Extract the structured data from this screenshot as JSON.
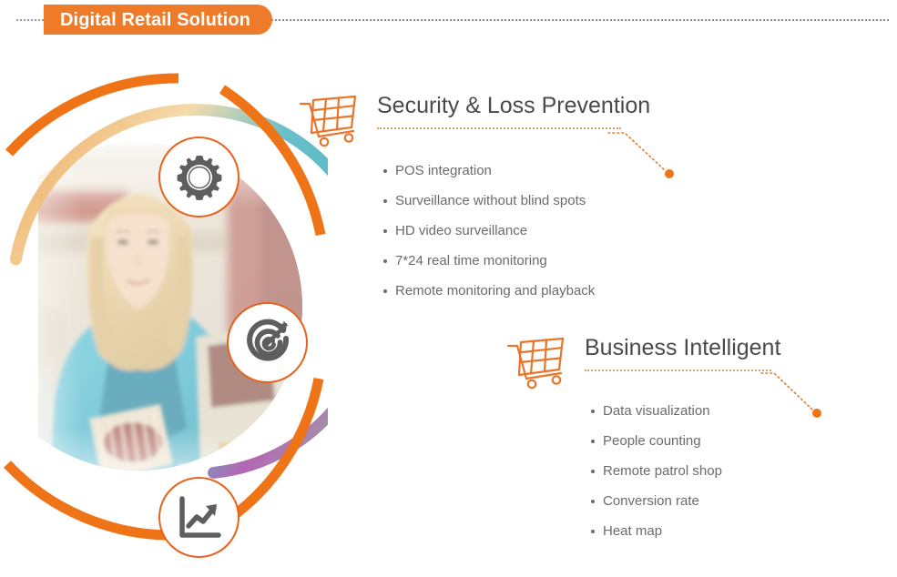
{
  "header": {
    "badge_title": "Digital Retail Solution",
    "badge_color": "#ED7B2A",
    "dotted_line_color": "#8d8d8d"
  },
  "theme": {
    "accent_orange": "#EE7417",
    "badge_orange": "#ED7B2A",
    "icon_gray": "#6B6B6B",
    "heading_gray": "#4A4A4A",
    "body_gray": "#6B6B6B",
    "rule_tan": "#D7A06A",
    "arc_teal": "#5BB7C4",
    "arc_purple": "#B05EAE",
    "arc_green": "#84C49A",
    "arc_cream": "#F3D9A8"
  },
  "left_graphic": {
    "outer_arc_name": "outer-orange-arc",
    "inner_arc_name": "inner-gradient-arc",
    "photo_alt": "woman shopping at retail checkout counter",
    "nodes": [
      {
        "id": "gear",
        "icon": "gear-icon"
      },
      {
        "id": "target",
        "icon": "target-arrow-icon"
      },
      {
        "id": "chart",
        "icon": "growth-chart-icon"
      }
    ]
  },
  "sections": [
    {
      "id": "security",
      "icon": "shopping-cart-icon",
      "title": "Security & Loss Prevention",
      "bullets": [
        "POS integration",
        "Surveillance without blind spots",
        "HD video surveillance",
        "7*24 real time monitoring",
        "Remote monitoring and playback"
      ]
    },
    {
      "id": "business_intelligent",
      "icon": "shopping-cart-icon",
      "title": "Business Intelligent",
      "bullets": [
        "Data visualization",
        "People counting",
        "Remote patrol shop",
        "Conversion rate",
        "Heat map"
      ]
    }
  ]
}
